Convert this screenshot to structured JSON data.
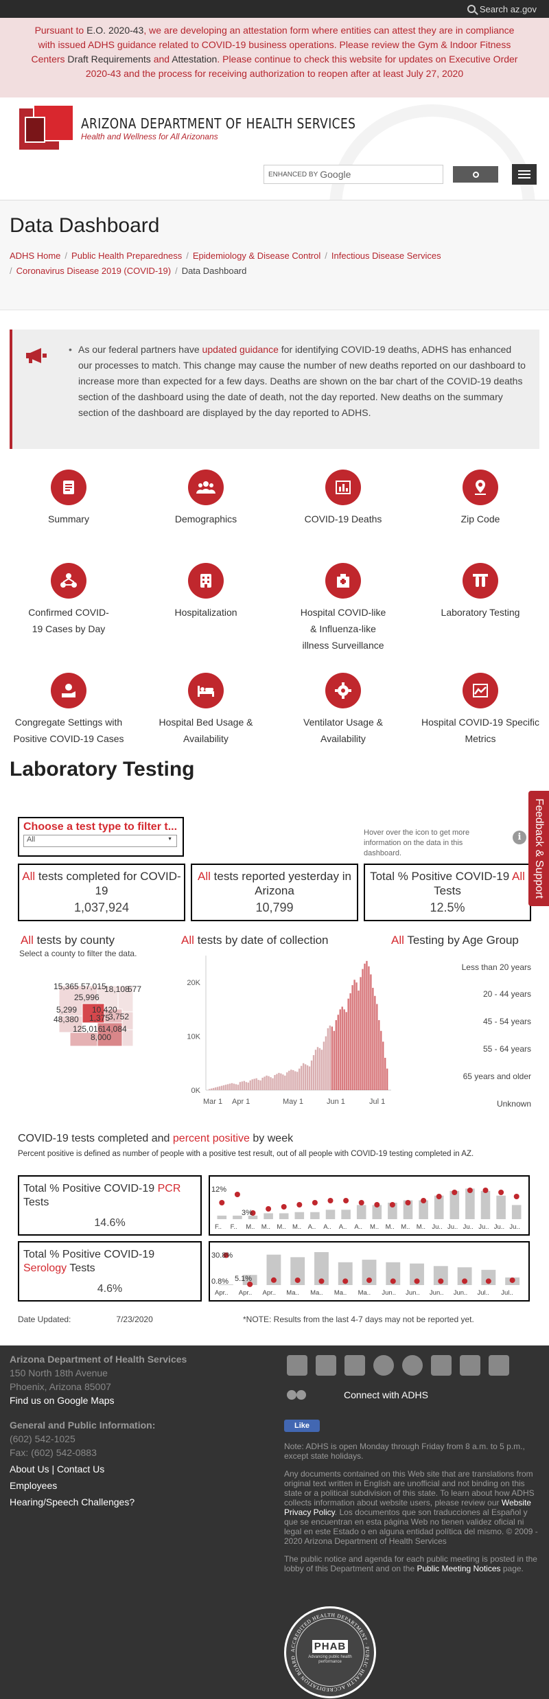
{
  "topbar": {
    "search_label": "Search az.gov"
  },
  "alert": {
    "lead": "Pursuant to ",
    "eo_link": "E.O. 2020-43",
    "mid": ", we are developing an attestation form where entities can attest they are in compliance with issued ADHS guidance related to COVID-19 business operations. Please review the Gym & Indoor Fitness Centers ",
    "draft": "Draft Requirements",
    "and": " and ",
    "attestation": "Attestation",
    "tail": ". Please continue to check this website for updates on Executive Order 2020-43 and the process for receiving authorization to reopen after at least July 27, 2020"
  },
  "header": {
    "title": "ARIZONA DEPARTMENT OF HEALTH SERVICES",
    "subtitle": "Health and Wellness for All Arizonans",
    "search_prefix": "ENHANCED BY",
    "search_brand": "Google"
  },
  "page": {
    "title": "Data Dashboard",
    "breadcrumbs": [
      "ADHS Home",
      "Public Health Preparedness",
      "Epidemiology & Disease Control",
      "Infectious Disease Services",
      "Coronavirus Disease 2019 (COVID-19)"
    ],
    "breadcrumb_current": "Data Dashboard"
  },
  "notice": {
    "pre": "As our federal partners have ",
    "link": "updated guidance",
    "post": " for identifying COVID-19 deaths, ADHS has enhanced our processes to match. This change may cause the number of new deaths reported on our dashboard to increase more than expected for a few days. Deaths are shown on the bar chart of the COVID-19 deaths section of the dashboard using the date of death, not the day reported. New deaths on the summary section of the dashboard are displayed by the day reported to ADHS."
  },
  "nav_grid": [
    {
      "label": "Summary",
      "icon": "document-icon"
    },
    {
      "label": "Demographics",
      "icon": "people-icon"
    },
    {
      "label": "COVID-19 Deaths",
      "icon": "bar-chart-icon"
    },
    {
      "label": "Zip Code",
      "icon": "map-pin-icon"
    },
    {
      "label": "Confirmed COVID-19 Cases by Day",
      "icon": "network-icon"
    },
    {
      "label": "Hospitalization",
      "icon": "building-icon"
    },
    {
      "label": "Hospital COVID-like & Influenza-like illness Surveillance",
      "icon": "hospital-icon"
    },
    {
      "label": "Laboratory Testing",
      "icon": "test-tube-icon"
    },
    {
      "label": "Congregate Settings with Positive COVID-19 Cases",
      "icon": "hand-icon"
    },
    {
      "label": "Hospital Bed Usage & Availability",
      "icon": "bed-icon"
    },
    {
      "label": "Ventilator Usage & Availability",
      "icon": "ventilator-icon"
    },
    {
      "label": "Hospital COVID-19 Specific Metrics",
      "icon": "trend-icon"
    }
  ],
  "section_title": "Laboratory Testing",
  "dashboard": {
    "filter_title": "Choose a test type to filter t...",
    "filter_value": "All",
    "hover_note": "Hover over the icon to get more information on the data in this dashboard.",
    "kpis": [
      {
        "red": "All",
        "text": " tests completed for COVID-19",
        "value": "1,037,924"
      },
      {
        "red": "All",
        "text": " tests reported yesterday in Arizona",
        "value": "10,799"
      },
      {
        "pre": "Total % Positive COVID-19 ",
        "red": "All",
        "text": " Tests",
        "value": "12.5%"
      }
    ],
    "county_head": {
      "red": "All",
      "text": " tests by county"
    },
    "county_sub": "Select a county to filter the data.",
    "map_labels": [
      "15,365",
      "57,015",
      "18,108",
      "577",
      "25,996",
      "5,299",
      "10,420",
      "48,380",
      "1,375",
      "3,752",
      "125,016",
      "14,084",
      "8,000"
    ],
    "date_head": {
      "red": "All",
      "text": " tests by date of collection"
    },
    "age_head": {
      "red": "All",
      "text": " Testing by Age Group"
    },
    "age_groups": [
      "Less than 20 years",
      "20 - 44 years",
      "45 - 54 years",
      "55 - 64 years",
      "65 years and older",
      "Unknown"
    ],
    "weekly_head": {
      "a": "COVID-19 tests completed",
      "b": " and ",
      "c": "percent positive",
      "d": " by week"
    },
    "weekly_sub": "Percent positive is defined as number of people with a positive test result, out of all people with COVID-19 testing completed in AZ.",
    "pcr": {
      "pre": "Total % Positive COVID-19 ",
      "red": "PCR",
      "post": " Tests",
      "value": "14.6%"
    },
    "serology": {
      "pre": "Total % Positive COVID-19 ",
      "red": "Serology",
      "post": " Tests",
      "value": "4.6%"
    },
    "date_updated_label": "Date Updated:",
    "date_updated_value": "7/23/2020",
    "note": "*NOTE: Results from the last 4-7 days may not be reported yet."
  },
  "chart_data": [
    {
      "type": "bar",
      "title": "All tests by date of collection",
      "x_ticks": [
        "Mar 1",
        "Apr 1",
        "May 1",
        "Jun 1",
        "Jul 1"
      ],
      "y_ticks": [
        "0K",
        "10K",
        "20K"
      ],
      "ylim": [
        0,
        25000
      ],
      "values": [
        200,
        300,
        400,
        500,
        600,
        700,
        800,
        900,
        1000,
        1100,
        1200,
        1300,
        1200,
        1100,
        1000,
        1500,
        1600,
        1700,
        1500,
        1400,
        1800,
        2000,
        2100,
        2200,
        1900,
        1800,
        2300,
        2500,
        2700,
        2600,
        2400,
        2200,
        2800,
        3000,
        3200,
        3100,
        2900,
        2700,
        3300,
        3600,
        3800,
        3700,
        3500,
        3400,
        4000,
        4500,
        5000,
        4800,
        4600,
        4400,
        5500,
        6500,
        7500,
        8000,
        7800,
        7500,
        9000,
        10000,
        11500,
        12000,
        11800,
        11000,
        13000,
        14000,
        15000,
        15500,
        15000,
        14500,
        17000,
        18000,
        19500,
        20500,
        20000,
        18500,
        21000,
        22500,
        23500,
        24000,
        23000,
        21500,
        19000,
        17500,
        16000,
        13000,
        11000,
        9000,
        6000,
        4000
      ]
    },
    {
      "type": "bar",
      "title": "PCR tests by week",
      "annotations": [
        "12%",
        "3%"
      ],
      "x_ticks": [
        "F..",
        "F..",
        "M..",
        "M..",
        "M..",
        "M..",
        "A..",
        "A..",
        "A..",
        "A..",
        "M..",
        "M..",
        "M..",
        "M..",
        "Ju..",
        "Ju..",
        "Ju..",
        "Ju..",
        "Ju..",
        "Ju.."
      ],
      "values": [
        1.5,
        1.5,
        1.5,
        2.5,
        2.5,
        3,
        3,
        4,
        4,
        6,
        6,
        7,
        8,
        8,
        10,
        12,
        13,
        12,
        10,
        6
      ],
      "percent_positive": [
        8,
        12,
        3,
        5,
        6,
        7,
        8,
        9,
        9,
        8,
        7,
        7,
        8,
        9,
        11,
        13,
        14,
        14,
        13,
        11
      ]
    },
    {
      "type": "bar",
      "title": "Serology tests by week",
      "annotations": [
        "30.8%",
        "0.8%",
        "5.1%"
      ],
      "x_ticks": [
        "Apr..",
        "Apr..",
        "Apr..",
        "Ma..",
        "Ma..",
        "Ma..",
        "Ma..",
        "Jun..",
        "Jun..",
        "Jun..",
        "Jun..",
        "Jul..",
        "Jul.."
      ],
      "values": [
        0.5,
        8,
        24,
        22,
        26,
        18,
        20,
        18,
        17,
        15,
        14,
        12,
        6
      ],
      "percent_positive": [
        30.8,
        0.8,
        5.1,
        5,
        4,
        4,
        5,
        4,
        4,
        4,
        4,
        4,
        5
      ]
    }
  ],
  "feedback_label": "Feedback & Support",
  "footer": {
    "org": "Arizona Department of Health Services",
    "address1": "150 North 18th Avenue",
    "address2": "Phoenix, Arizona 85007",
    "maps_link": "Find us on Google Maps",
    "general": "General and Public Information:",
    "phone": "(602) 542-1025",
    "fax": "Fax: (602) 542-0883",
    "about": "About Us",
    "contact": "Contact Us",
    "employees": "Employees",
    "hearing": "Hearing/Speech Challenges?",
    "connect": "Connect with ADHS",
    "like": "Like",
    "hours_note": "Note: ADHS is open Monday through Friday from 8 a.m. to 5 p.m., except state holidays.",
    "translation_pre": "Any documents contained on this Web site that are translations from original text written in English are unofficial and not binding on this state or a political subdivision of this state. To learn about how ADHS collects information about website users, please review our ",
    "privacy": "Website Privacy Policy",
    "translation_post": ". Los documentos que son traducciones al Español y que se encuentran en esta página Web no tienen validez oficial ni legal en este Estado o en alguna entidad política del mismo. © 2009 - 2020 Arizona Department of Health Services",
    "meetings_pre": "The public notice and agenda for each public meeting is posted in the lobby of this Department and on the ",
    "meetings_link": "Public Meeting Notices",
    "meetings_post": " page.",
    "phab_logo": "PHAB",
    "phab_ring": "ACCREDITED HEALTH DEPARTMENT · PUBLIC HEALTH ACCREDITATION BOARD",
    "phab_tag": "Advancing public health performance"
  },
  "colors": {
    "accent": "#b5262e",
    "bar": "#d9aeb0",
    "bar_recent": "#c9474c",
    "dot": "#c0272d"
  }
}
